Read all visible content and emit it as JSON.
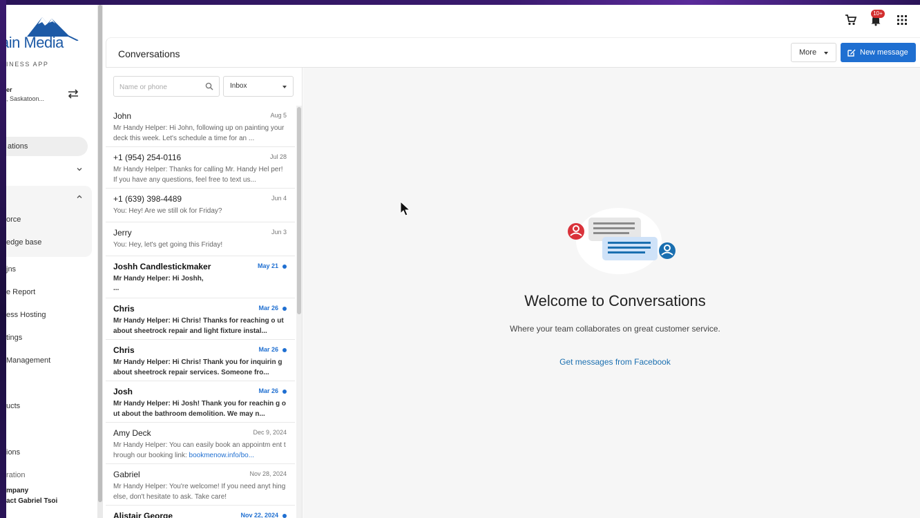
{
  "brand": {
    "logo_text": "ain Media",
    "subtitle": "INESS APP",
    "account_name": "er",
    "account_location": ", Saskatoon..."
  },
  "sidebar": {
    "items": [
      {
        "label": "ations",
        "active": true
      },
      {
        "label": ""
      },
      {
        "label": ""
      },
      {
        "label": "orce"
      },
      {
        "label": "edge base"
      },
      {
        "label": "jns"
      },
      {
        "label": "e Report"
      },
      {
        "label": "ess Hosting"
      },
      {
        "label": "tings"
      },
      {
        "label": "Management"
      },
      {
        "label": "ucts"
      },
      {
        "label": "ions"
      },
      {
        "label": "ration"
      }
    ],
    "footer_company": "mpany",
    "footer_contact": "act Gabriel Tsoi"
  },
  "topbar": {
    "cart_icon": "cart-icon",
    "notifications_badge": "10+",
    "apps_icon": "grid-icon"
  },
  "header": {
    "title": "Conversations",
    "more_label": "More",
    "new_message_label": "New message"
  },
  "filters": {
    "search_placeholder": "Name or phone",
    "inbox_value": "Inbox"
  },
  "conversations": [
    {
      "name": "John",
      "date": "Aug 5",
      "preview": "Mr Handy Helper: Hi John, following up on painting your deck this week. Let's schedule a time for an ...",
      "unread": false
    },
    {
      "name": "+1 (954) 254-0116",
      "date": "Jul 28",
      "preview": "Mr Handy Helper: Thanks for calling Mr. Handy Hel per! If you have any questions, feel free to text us...",
      "unread": false
    },
    {
      "name": "+1 (639) 398-4489",
      "date": "Jun 4",
      "preview": "You: Hey! Are we still ok for Friday?",
      "unread": false
    },
    {
      "name": "Jerry",
      "date": "Jun 3",
      "preview": "You: Hey, let's get going this Friday!",
      "unread": false
    },
    {
      "name": "Joshh Candlestickmaker",
      "date": "May 21",
      "preview": "Mr Handy Helper: Hi Joshh,",
      "preview_extra": "...",
      "unread": true
    },
    {
      "name": "Chris",
      "date": "Mar 26",
      "preview": "Mr Handy Helper: Hi Chris! Thanks for reaching o ut about sheetrock repair and light fixture instal...",
      "unread": true
    },
    {
      "name": "Chris",
      "date": "Mar 26",
      "preview": "Mr Handy Helper: Hi Chris! Thank you for inquirin g about sheetrock repair services. Someone fro...",
      "unread": true
    },
    {
      "name": "Josh",
      "date": "Mar 26",
      "preview": "Mr Handy Helper: Hi Josh! Thank you for reachin g out about the bathroom demolition. We may n...",
      "unread": true
    },
    {
      "name": "Amy Deck",
      "date": "Dec 9, 2024",
      "preview": "Mr Handy Helper: You can easily book an appointm ent through our booking link: ",
      "preview_link": "bookmenow.info/bo...",
      "unread": false
    },
    {
      "name": "Gabriel",
      "date": "Nov 28, 2024",
      "preview": "Mr Handy Helper: You're welcome! If you need anyt hing else, don't hesitate to ask. Take care!",
      "unread": false
    },
    {
      "name": "Alistair George",
      "date": "Nov 22, 2024",
      "preview": "",
      "unread": true
    }
  ],
  "main": {
    "welcome_title": "Welcome to Conversations",
    "welcome_subtitle": "Where your team collaborates on great customer service.",
    "facebook_link": "Get messages from Facebook"
  },
  "colors": {
    "primary": "#1f6fd1",
    "badge": "#d32f2f",
    "avatar_red": "#d9323a",
    "avatar_blue": "#1a6fb0"
  }
}
